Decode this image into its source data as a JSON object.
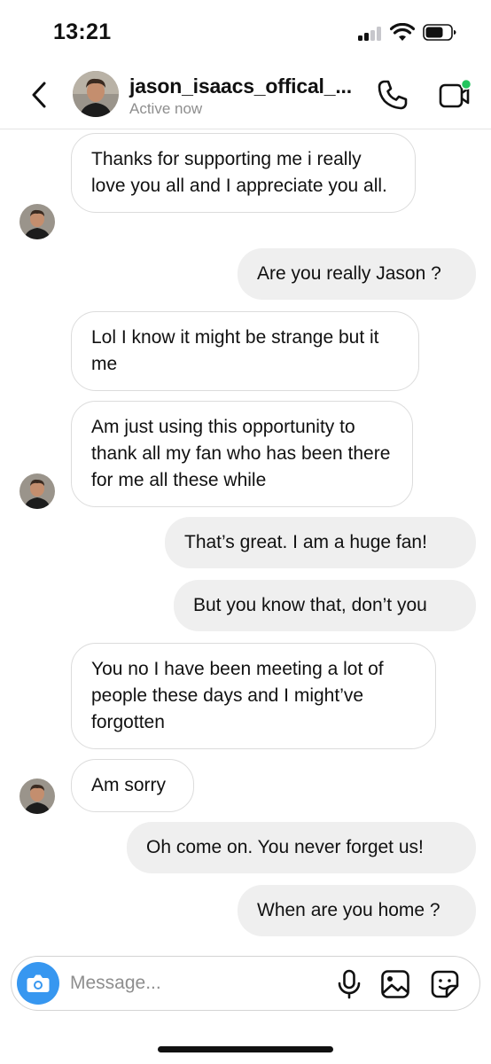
{
  "status_bar": {
    "time": "13:21"
  },
  "header": {
    "contact_name": "jason_isaacs_offical_...",
    "status": "Active now"
  },
  "messages": [
    {
      "side": "received",
      "text": "Thanks for supporting me i really love you all and I appreciate you all."
    },
    {
      "side": "sent",
      "text": "Are you really Jason ?"
    },
    {
      "side": "received",
      "text": "Lol I know it might be strange but it me"
    },
    {
      "side": "received",
      "text": "Am just using this opportunity to thank all my fan who has been there for me all these while"
    },
    {
      "side": "sent",
      "text": "That’s great.  I am a huge fan!"
    },
    {
      "side": "sent",
      "text": "But you know that, don’t you"
    },
    {
      "side": "received",
      "text": "You no I have been meeting a lot of people these days and I might’ve forgotten"
    },
    {
      "side": "received",
      "text": "Am sorry"
    },
    {
      "side": "sent",
      "text": "Oh come on.  You never forget us!"
    },
    {
      "side": "sent",
      "text": "When are you home ?"
    }
  ],
  "composer": {
    "placeholder": "Message..."
  },
  "icons": {
    "back": "chevron-left-icon",
    "call": "phone-icon",
    "video": "video-camera-icon",
    "camera": "camera-icon",
    "mic": "microphone-icon",
    "gallery": "image-icon",
    "sticker": "sticker-icon"
  },
  "colors": {
    "accent": "#3797f0",
    "online_dot": "#22c55e",
    "sent_bubble": "#efefef",
    "received_border": "#dcdcdc",
    "secondary_text": "#8e8e8e"
  }
}
